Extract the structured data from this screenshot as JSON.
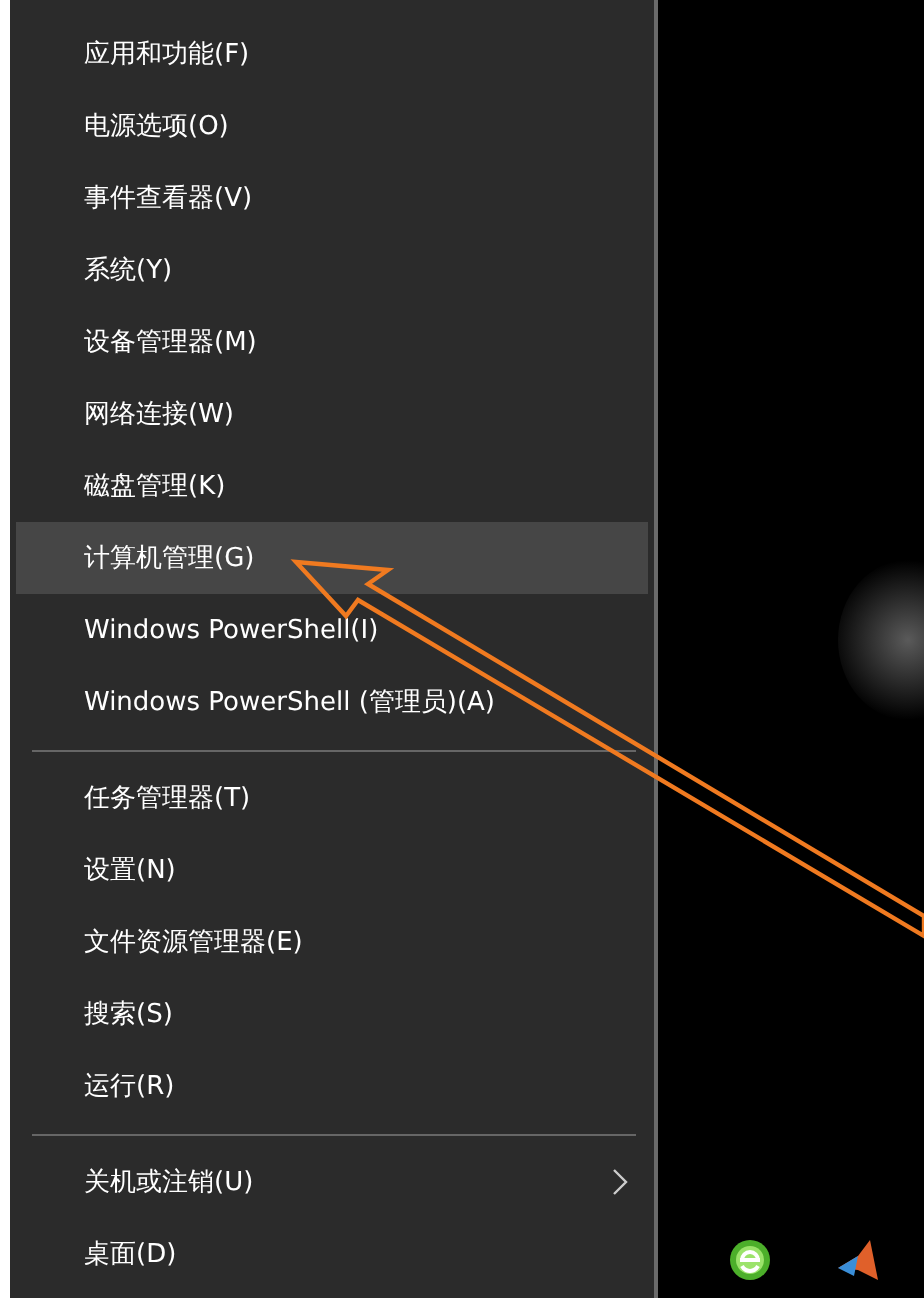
{
  "menu": {
    "groups": [
      {
        "items": [
          {
            "label": "应用和功能(F)",
            "selected": false,
            "submenu": false
          },
          {
            "label": "电源选项(O)",
            "selected": false,
            "submenu": false
          },
          {
            "label": "事件查看器(V)",
            "selected": false,
            "submenu": false
          },
          {
            "label": "系统(Y)",
            "selected": false,
            "submenu": false
          },
          {
            "label": "设备管理器(M)",
            "selected": false,
            "submenu": false
          },
          {
            "label": "网络连接(W)",
            "selected": false,
            "submenu": false
          },
          {
            "label": "磁盘管理(K)",
            "selected": false,
            "submenu": false
          },
          {
            "label": "计算机管理(G)",
            "selected": true,
            "submenu": false
          },
          {
            "label": "Windows PowerShell(I)",
            "selected": false,
            "submenu": false
          },
          {
            "label": "Windows PowerShell (管理员)(A)",
            "selected": false,
            "submenu": false
          }
        ]
      },
      {
        "items": [
          {
            "label": "任务管理器(T)",
            "selected": false,
            "submenu": false
          },
          {
            "label": "设置(N)",
            "selected": false,
            "submenu": false
          },
          {
            "label": "文件资源管理器(E)",
            "selected": false,
            "submenu": false
          },
          {
            "label": "搜索(S)",
            "selected": false,
            "submenu": false
          },
          {
            "label": "运行(R)",
            "selected": false,
            "submenu": false
          }
        ]
      },
      {
        "items": [
          {
            "label": "关机或注销(U)",
            "selected": false,
            "submenu": true
          },
          {
            "label": "桌面(D)",
            "selected": false,
            "submenu": false
          }
        ]
      }
    ]
  }
}
